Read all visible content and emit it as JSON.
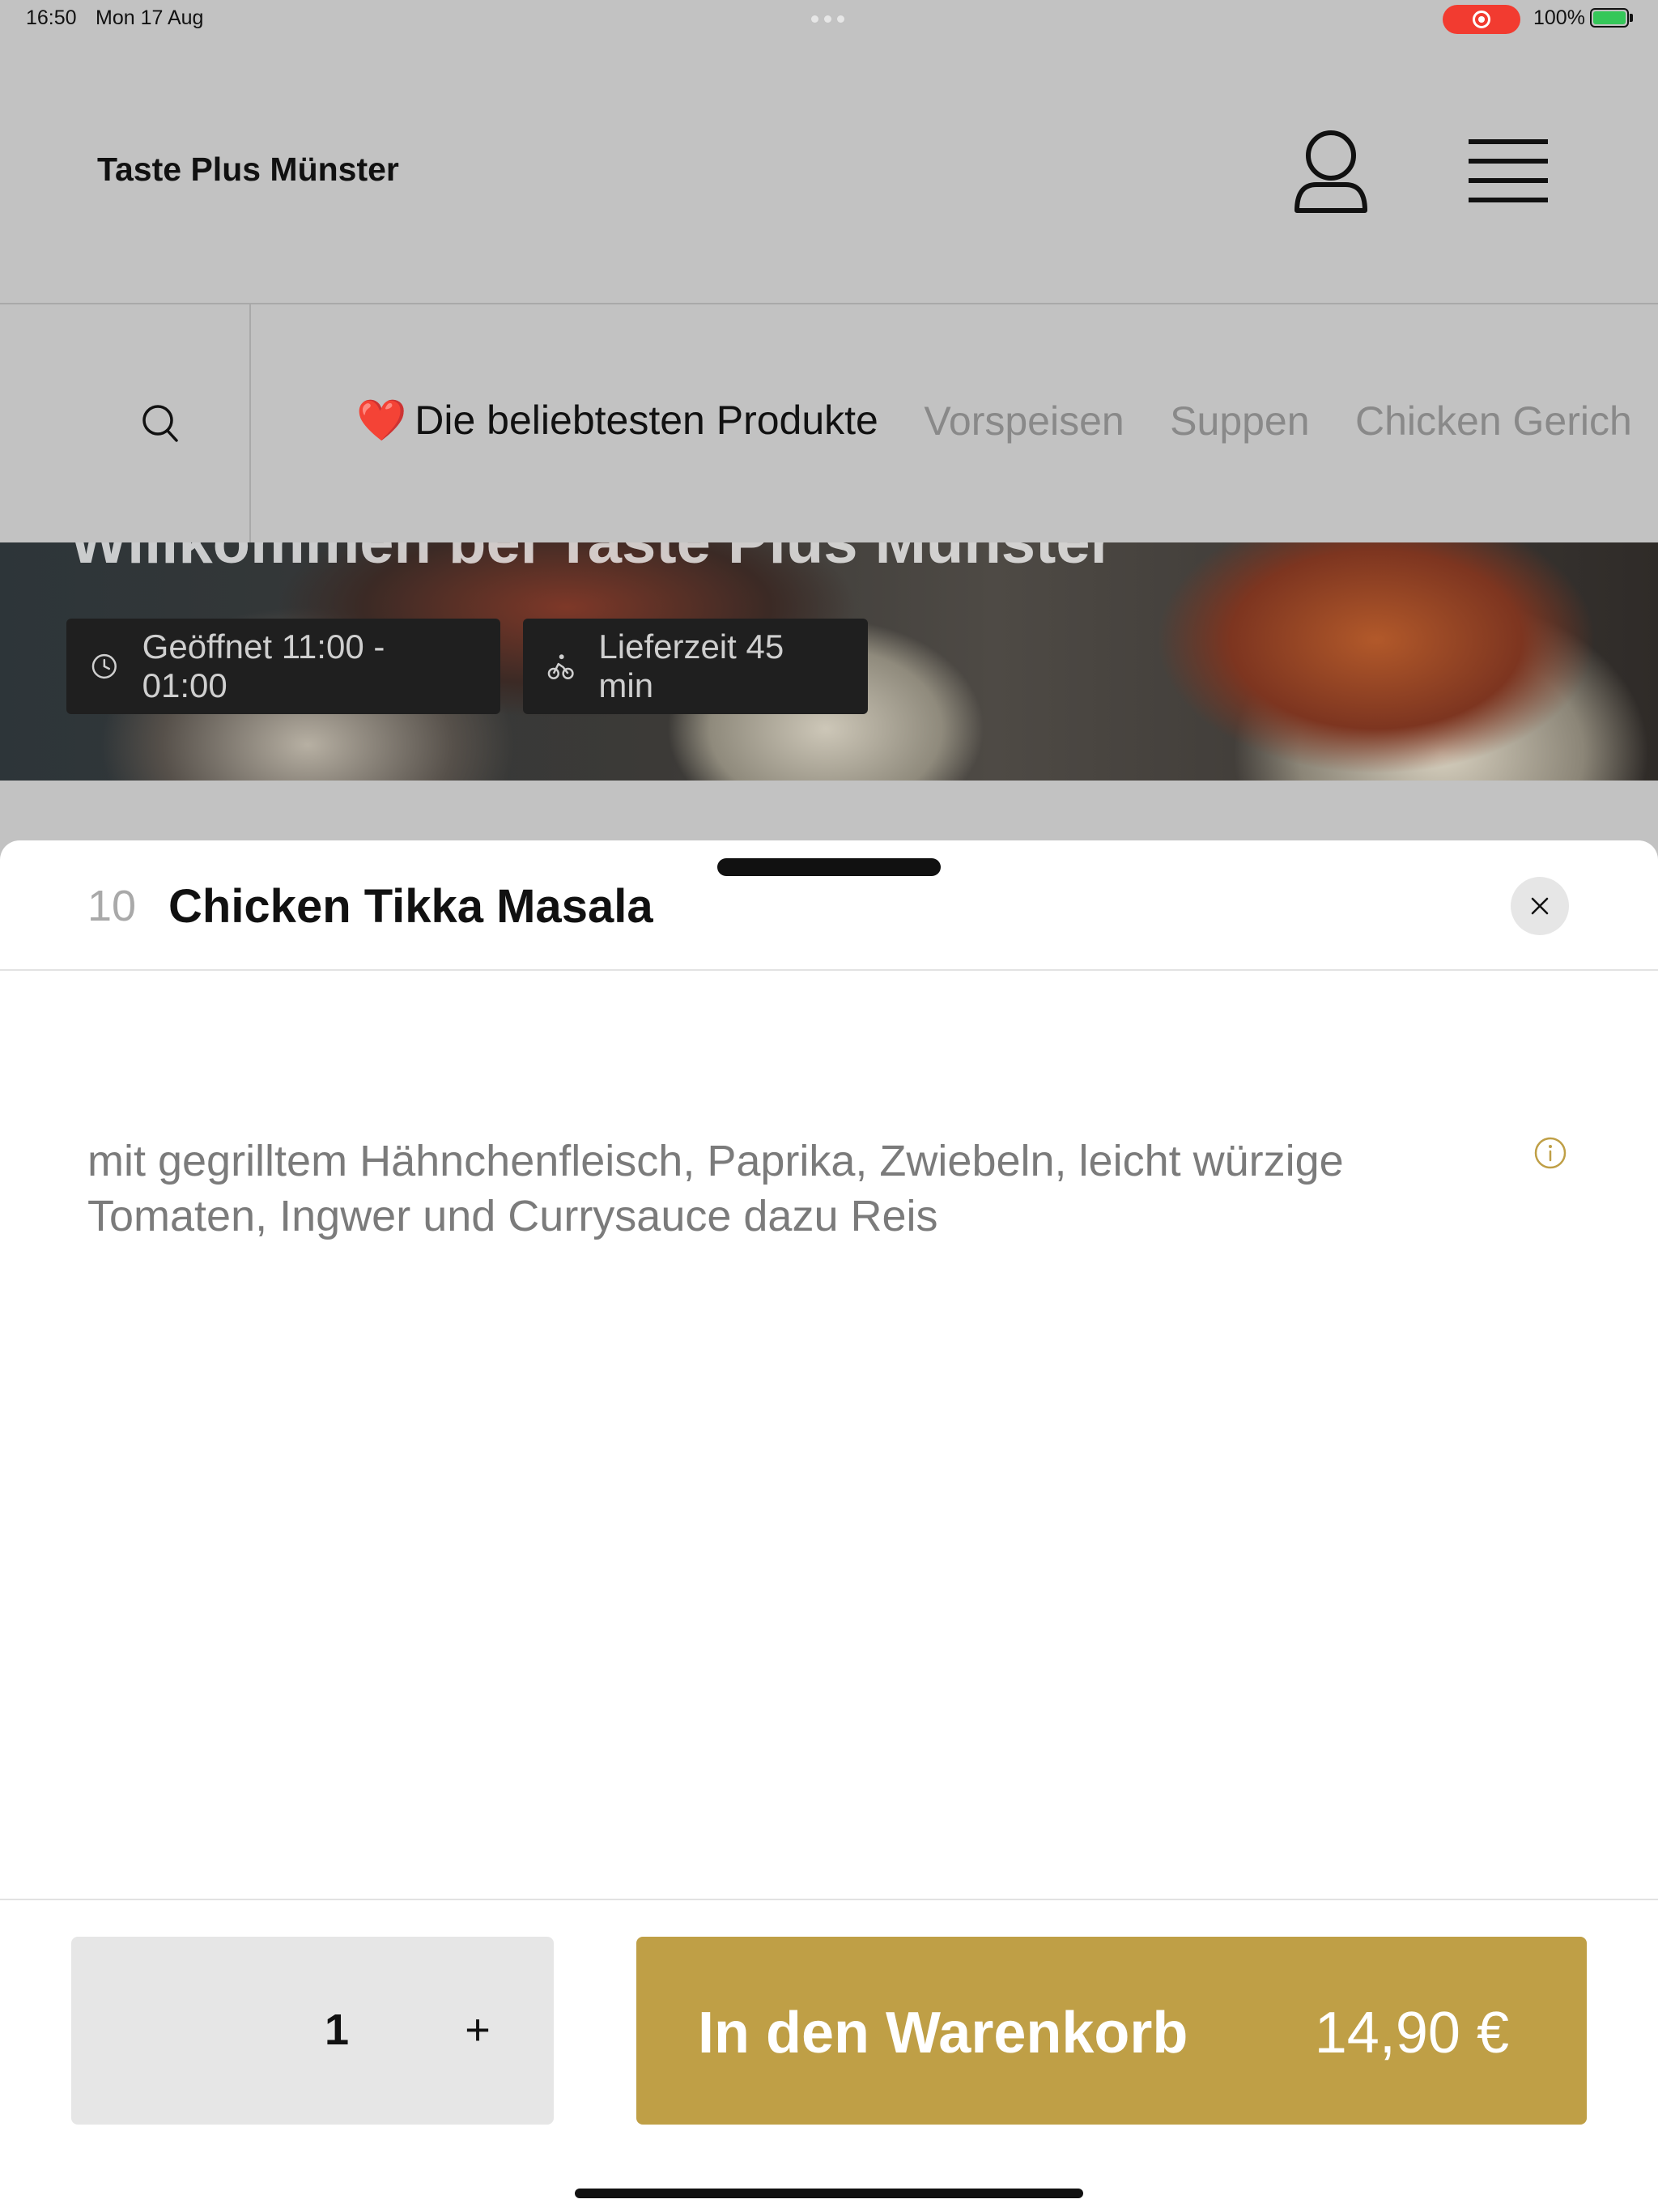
{
  "status_bar": {
    "time": "16:50",
    "date": "Mon 17 Aug",
    "battery": "100%",
    "recording_color": "#f23b30",
    "battery_fill_color": "#35c759"
  },
  "header": {
    "brand": "Taste Plus Münster",
    "account_icon": "person-outline-icon",
    "menu_icon": "hamburger-menu-icon"
  },
  "category_nav": {
    "search_icon": "search-icon",
    "items": [
      {
        "label": "Die beliebtesten Produkte",
        "emoji": "❤️",
        "active": true
      },
      {
        "label": "Vorspeisen",
        "active": false
      },
      {
        "label": "Suppen",
        "active": false
      },
      {
        "label": "Chicken Gerich",
        "active": false
      }
    ]
  },
  "hero": {
    "title": "Willkommen bei Taste Plus Münster",
    "opening_hours": "Geöffnet 11:00 - 01:00",
    "delivery_time": "Lieferzeit 45 min"
  },
  "product_sheet": {
    "number": "10",
    "title": "Chicken Tikka Masala",
    "description": "mit gegrilltem Hähnchenfleisch, Paprika, Zwiebeln, leicht würzige Tomaten, Ingwer und Currysauce dazu Reis",
    "quantity": "1",
    "plus_label": "+",
    "add_to_cart_label": "In den Warenkorb",
    "price": "14,90 €",
    "accent_color": "#bf9f46"
  }
}
